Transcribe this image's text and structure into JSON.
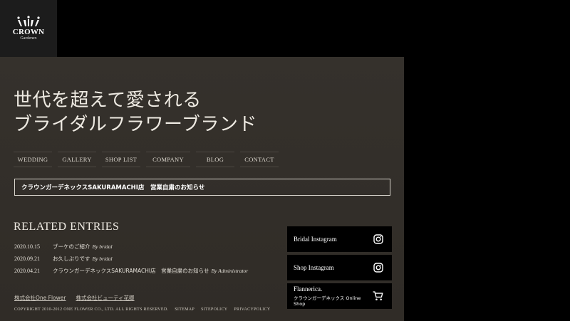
{
  "logo": {
    "name": "CROWN",
    "sub": "Gardenex"
  },
  "hero": {
    "line1": "世代を超えて愛される",
    "line2": "ブライダルフラワーブランド"
  },
  "nav": [
    {
      "label": "WEDDING"
    },
    {
      "label": "GALLERY"
    },
    {
      "label": "SHOP LIST"
    },
    {
      "label": "COMPANY"
    },
    {
      "label": "BLOG"
    },
    {
      "label": "CONTACT"
    }
  ],
  "notice": {
    "text": "クラウンガーデネックスSAKURAMACHI店　営業自粛のお知らせ"
  },
  "related": {
    "title": "RELATED ENTRIES",
    "entries": [
      {
        "date": "2020.10.15",
        "title": "ブーケのご紹介",
        "by": "By bridal"
      },
      {
        "date": "2020.09.21",
        "title": "お久しぶりです",
        "by": "By bridal"
      },
      {
        "date": "2020.04.21",
        "title": "クラウンガーデネックスSAKURAMACHI店　営業自粛のお知らせ",
        "by": "By Administrator"
      }
    ]
  },
  "companies": [
    "株式会社One Flower",
    "株式会社ビューティ花卿"
  ],
  "footer": {
    "copyright": "COPYRIGHT 2010-2012 ONE FLOWER CO., LTD. ALL RIGHTS RESERVED.",
    "links": [
      "SITEMAP",
      "SITEPOLICY",
      "PRIVACYPOLICY"
    ]
  },
  "sidebar": {
    "bridal_instagram": "Bridal Instagram",
    "shop_instagram": "Shop Instagram",
    "flannerica": "Flannerica.",
    "flannerica_sub": "クラウンガーデネックス Online Shop"
  },
  "colors": {
    "panel_bg": "#35312c",
    "page_bg": "#000000",
    "text": "#e8e4dc"
  },
  "icons": [
    "crown-icon",
    "instagram-icon",
    "cart-icon"
  ]
}
